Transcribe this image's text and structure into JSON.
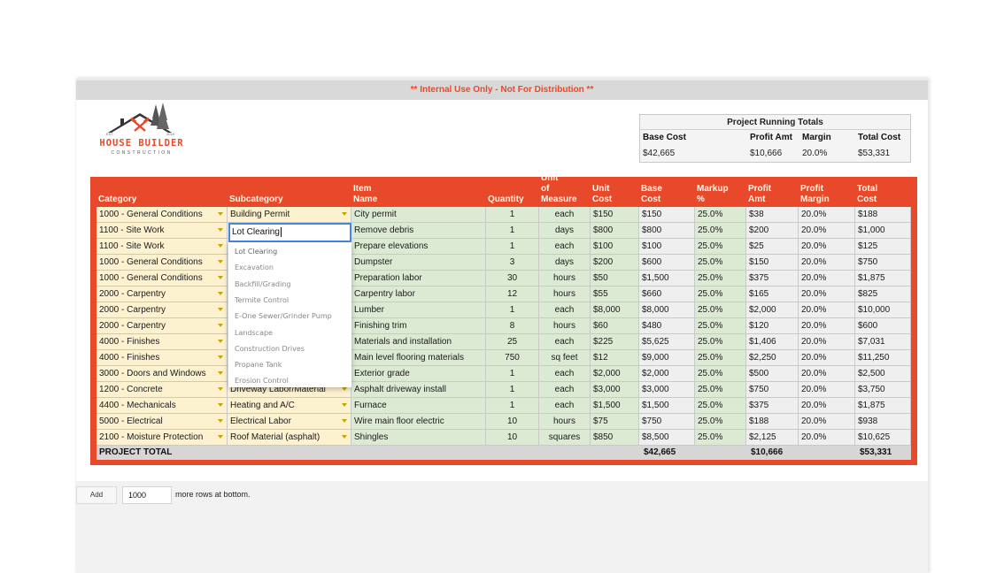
{
  "banner": {
    "text": "** Internal Use Only - Not For Distribution **"
  },
  "logo": {
    "name": "HOUSE BUILDER",
    "sub": "CONSTRUCTION",
    "est": "EST.",
    "year": "2019"
  },
  "running_totals": {
    "title": "Project Running Totals",
    "headers": [
      "Base Cost",
      "Profit Amt",
      "Margin",
      "Total Cost"
    ],
    "values": [
      "$42,665",
      "$10,666",
      "20.0%",
      "$53,331"
    ]
  },
  "table": {
    "headers": {
      "category": "Category",
      "subcategory": "Subcategory",
      "item_name": "Item Name",
      "quantity": "Quantity",
      "uom_1": "Unit of",
      "uom_2": "Measure",
      "unit_cost": "Unit Cost",
      "base_cost": "Base Cost",
      "markup": "Markup %",
      "profit_amt": "Profit Amt",
      "margin_1": "Profit",
      "margin_2": "Margin",
      "total_cost": "Total Cost"
    },
    "rows": [
      {
        "category": "1000 - General Conditions",
        "subcategory": "Building Permit",
        "item": "City permit",
        "qty": "1",
        "uom": "each",
        "unit": "$150",
        "base": "$150",
        "markup": "25.0%",
        "profit": "$38",
        "margin": "20.0%",
        "total": "$188"
      },
      {
        "category": "1100 - Site Work",
        "subcategory": "Lot Clearing",
        "item": "Remove debris",
        "qty": "1",
        "uom": "days",
        "unit": "$800",
        "base": "$800",
        "markup": "25.0%",
        "profit": "$200",
        "margin": "20.0%",
        "total": "$1,000"
      },
      {
        "category": "1100 - Site Work",
        "subcategory": "",
        "item": "Prepare elevations",
        "qty": "1",
        "uom": "each",
        "unit": "$100",
        "base": "$100",
        "markup": "25.0%",
        "profit": "$25",
        "margin": "20.0%",
        "total": "$125"
      },
      {
        "category": "1000 - General Conditions",
        "subcategory": "",
        "item": "Dumpster",
        "qty": "3",
        "uom": "days",
        "unit": "$200",
        "base": "$600",
        "markup": "25.0%",
        "profit": "$150",
        "margin": "20.0%",
        "total": "$750"
      },
      {
        "category": "1000 - General Conditions",
        "subcategory": "",
        "item": "Preparation labor",
        "qty": "30",
        "uom": "hours",
        "unit": "$50",
        "base": "$1,500",
        "markup": "25.0%",
        "profit": "$375",
        "margin": "20.0%",
        "total": "$1,875"
      },
      {
        "category": "2000 - Carpentry",
        "subcategory": "",
        "item": "Carpentry labor",
        "qty": "12",
        "uom": "hours",
        "unit": "$55",
        "base": "$660",
        "markup": "25.0%",
        "profit": "$165",
        "margin": "20.0%",
        "total": "$825"
      },
      {
        "category": "2000 - Carpentry",
        "subcategory": "",
        "item": "Lumber",
        "qty": "1",
        "uom": "each",
        "unit": "$8,000",
        "base": "$8,000",
        "markup": "25.0%",
        "profit": "$2,000",
        "margin": "20.0%",
        "total": "$10,000"
      },
      {
        "category": "2000 - Carpentry",
        "subcategory": "",
        "item": "Finishing trim",
        "qty": "8",
        "uom": "hours",
        "unit": "$60",
        "base": "$480",
        "markup": "25.0%",
        "profit": "$120",
        "margin": "20.0%",
        "total": "$600"
      },
      {
        "category": "4000 - Finishes",
        "subcategory": "",
        "item": "Materials and installation",
        "qty": "25",
        "uom": "each",
        "unit": "$225",
        "base": "$5,625",
        "markup": "25.0%",
        "profit": "$1,406",
        "margin": "20.0%",
        "total": "$7,031"
      },
      {
        "category": "4000 - Finishes",
        "subcategory": "",
        "item": "Main level flooring materials",
        "qty": "750",
        "uom": "sq feet",
        "unit": "$12",
        "base": "$9,000",
        "markup": "25.0%",
        "profit": "$2,250",
        "margin": "20.0%",
        "total": "$11,250"
      },
      {
        "category": "3000 - Doors and Windows",
        "subcategory": "",
        "item": "Exterior grade",
        "qty": "1",
        "uom": "each",
        "unit": "$2,000",
        "base": "$2,000",
        "markup": "25.0%",
        "profit": "$500",
        "margin": "20.0%",
        "total": "$2,500"
      },
      {
        "category": "1200 - Concrete",
        "subcategory": "Driveway Labor/Material",
        "item": "Asphalt driveway install",
        "qty": "1",
        "uom": "each",
        "unit": "$3,000",
        "base": "$3,000",
        "markup": "25.0%",
        "profit": "$750",
        "margin": "20.0%",
        "total": "$3,750"
      },
      {
        "category": "4400 - Mechanicals",
        "subcategory": "Heating and A/C",
        "item": "Furnace",
        "qty": "1",
        "uom": "each",
        "unit": "$1,500",
        "base": "$1,500",
        "markup": "25.0%",
        "profit": "$375",
        "margin": "20.0%",
        "total": "$1,875"
      },
      {
        "category": "5000 - Electrical",
        "subcategory": "Electrical Labor",
        "item": "Wire main floor electric",
        "qty": "10",
        "uom": "hours",
        "unit": "$75",
        "base": "$750",
        "markup": "25.0%",
        "profit": "$188",
        "margin": "20.0%",
        "total": "$938"
      },
      {
        "category": "2100 - Moisture Protection",
        "subcategory": "Roof Material (asphalt)",
        "item": "Shingles",
        "qty": "10",
        "uom": "squares",
        "unit": "$850",
        "base": "$8,500",
        "markup": "25.0%",
        "profit": "$2,125",
        "margin": "20.0%",
        "total": "$10,625"
      }
    ],
    "total": {
      "label": "PROJECT TOTAL",
      "base": "$42,665",
      "profit": "$10,666",
      "total": "$53,331"
    }
  },
  "editor": {
    "value": "Lot Clearing"
  },
  "dropdown": {
    "options": [
      "Lot Clearing",
      "Excavation",
      "Backfill/Grading",
      "Termite Control",
      "E-One Sewer/Grinder Pump",
      "Landscape",
      "Construction Drives",
      "Propane Tank",
      "Erosion Control"
    ]
  },
  "add_rows": {
    "button": "Add",
    "count": "1000",
    "suffix": "more rows at bottom."
  }
}
